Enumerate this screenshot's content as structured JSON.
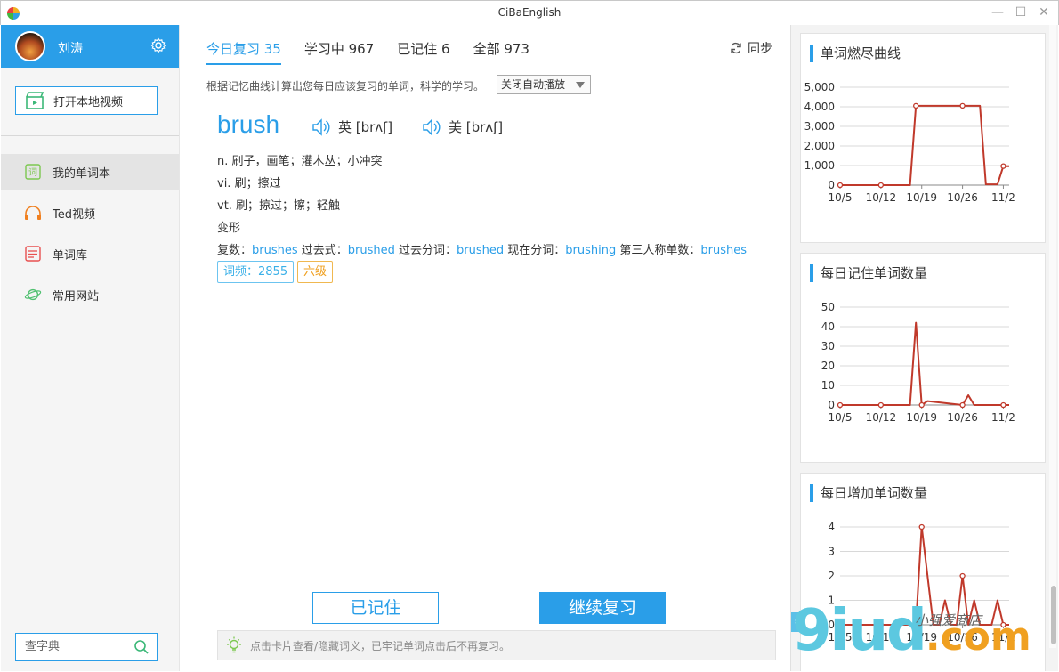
{
  "window": {
    "title": "CiBaEnglish"
  },
  "sidebar": {
    "user_name": "刘涛",
    "open_video_label": "打开本地视频",
    "items": [
      {
        "label": "我的单词本",
        "icon": "vocab-book-icon",
        "active": true
      },
      {
        "label": "Ted视频",
        "icon": "headphones-icon",
        "active": false
      },
      {
        "label": "单词库",
        "icon": "word-library-icon",
        "active": false
      },
      {
        "label": "常用网站",
        "icon": "planet-icon",
        "active": false
      }
    ],
    "dict_search_placeholder": "查字典"
  },
  "main": {
    "tabs": [
      {
        "label": "今日复习 35",
        "active": true
      },
      {
        "label": "学习中 967",
        "active": false
      },
      {
        "label": "已记住 6",
        "active": false
      },
      {
        "label": "全部 973",
        "active": false
      }
    ],
    "sync_label": "同步",
    "hint": "根据记忆曲线计算出您每日应该复习的单词，科学的学习。",
    "autoplay_label": "关闭自动播放",
    "word": "brush",
    "pron_uk": "英 [brʌʃ]",
    "pron_us": "美 [brʌʃ]",
    "definitions": [
      "n.  刷子，画笔；灌木丛；小冲突",
      "vi.  刷；擦过",
      "vt.  刷；掠过；擦；轻触",
      "变形"
    ],
    "forms": {
      "plural_label": "复数：",
      "plural": "brushes",
      "past_label": " 过去式：",
      "past": "brushed",
      "pp_label": " 过去分词：",
      "pp": "brushed",
      "ing_label": " 现在分词：",
      "ing": "brushing",
      "third_label": " 第三人称单数：",
      "third": "brushes"
    },
    "freq_badge": "词频：2855",
    "level_badge": "六级",
    "remember_button": "已记住",
    "continue_button": "继续复习",
    "tip": "点击卡片查看/隐藏词义，已牢记单词点击后不再复习。"
  },
  "chart_data": [
    {
      "type": "line",
      "title": "单词燃尽曲线",
      "x_ticks": [
        "10/5",
        "10/12",
        "10/19",
        "10/26",
        "11/2"
      ],
      "x": [
        0,
        7,
        12,
        13,
        21,
        24,
        25,
        27,
        28,
        29
      ],
      "values": [
        0,
        0,
        0,
        4050,
        4050,
        4050,
        40,
        40,
        970,
        970
      ],
      "markers": [
        0,
        7,
        13,
        21,
        28
      ],
      "y_ticks": [
        "0",
        "1,000",
        "2,000",
        "3,000",
        "4,000",
        "5,000"
      ],
      "ylim": [
        0,
        5000
      ],
      "color": "#c0392b"
    },
    {
      "type": "line",
      "title": "每日记住单词数量",
      "x_ticks": [
        "10/5",
        "10/12",
        "10/19",
        "10/26",
        "11/2"
      ],
      "x": [
        0,
        7,
        12,
        13,
        14,
        15,
        21,
        22,
        23,
        28,
        29
      ],
      "values": [
        0,
        0,
        0,
        42,
        0,
        2,
        0,
        5,
        0,
        0,
        0
      ],
      "markers": [
        0,
        7,
        14,
        21,
        28
      ],
      "y_ticks": [
        "0",
        "10",
        "20",
        "30",
        "40",
        "50"
      ],
      "ylim": [
        0,
        50
      ],
      "color": "#c0392b"
    },
    {
      "type": "line",
      "title": "每日增加单词数量",
      "x_ticks": [
        "10/5",
        "10/12",
        "10/19",
        "10/26",
        "11/2"
      ],
      "x": [
        0,
        7,
        13,
        14,
        16,
        17,
        18,
        19,
        20,
        21,
        22,
        23,
        24,
        26,
        27,
        28,
        29
      ],
      "values": [
        0,
        0,
        0,
        4,
        0,
        0,
        1,
        0,
        0,
        2,
        0,
        1,
        0,
        0,
        1,
        0,
        0
      ],
      "markers": [
        0,
        7,
        14,
        21,
        28
      ],
      "y_ticks": [
        "0",
        "1",
        "2",
        "3",
        "4"
      ],
      "ylim": [
        0,
        4
      ],
      "color": "#c0392b"
    }
  ],
  "watermark": {
    "main": "9iud",
    "dot": ".com",
    "sub": "小强爱商店"
  }
}
